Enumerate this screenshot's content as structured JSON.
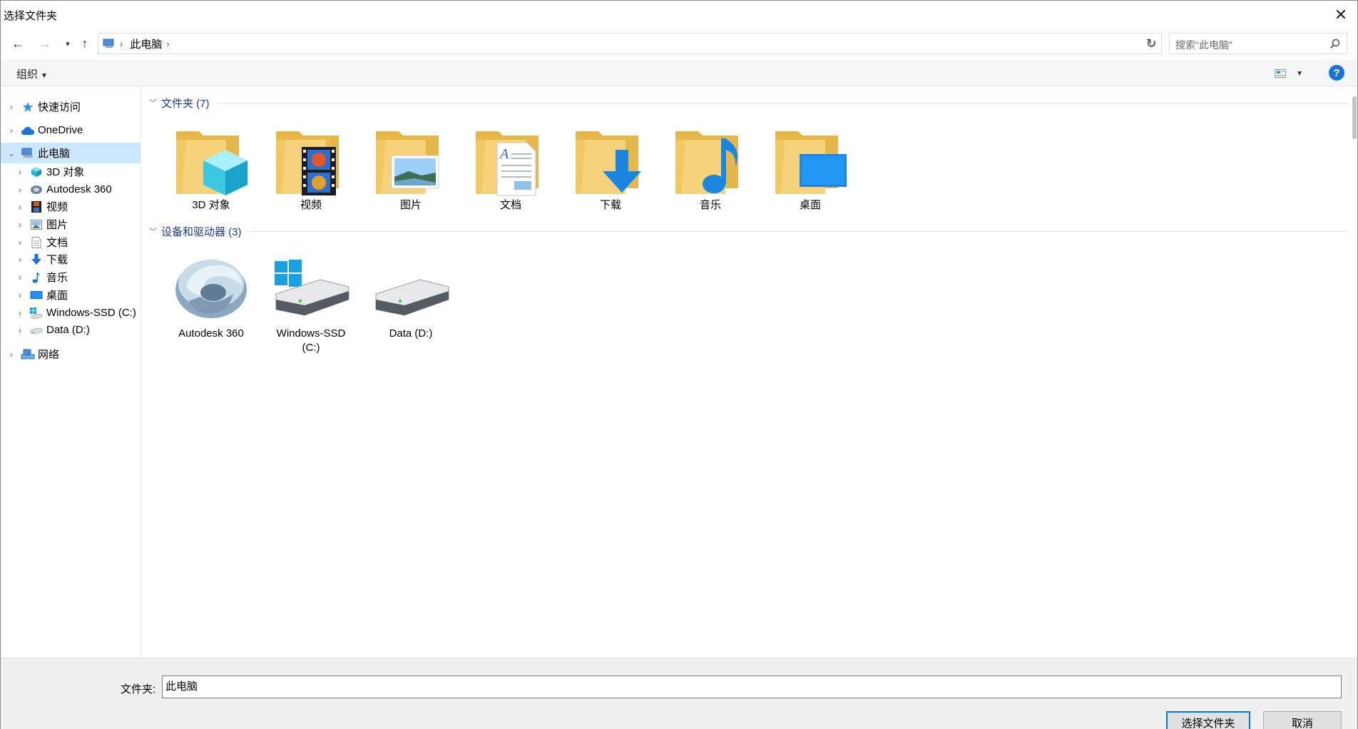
{
  "window": {
    "title": "选择文件夹"
  },
  "nav": {
    "address_path": "此电脑",
    "search_placeholder": "搜索\"此电脑\""
  },
  "toolbar": {
    "organize_label": "组织"
  },
  "tree": [
    {
      "label": "快速访问",
      "icon": "star-icon"
    },
    {
      "label": "OneDrive",
      "icon": "cloud-icon"
    },
    {
      "label": "此电脑",
      "icon": "computer-icon",
      "selected": true
    },
    {
      "label": "3D 对象",
      "icon": "cube-icon"
    },
    {
      "label": "Autodesk 360",
      "icon": "autodesk-icon"
    },
    {
      "label": "视频",
      "icon": "film-icon"
    },
    {
      "label": "图片",
      "icon": "picture-icon"
    },
    {
      "label": "文档",
      "icon": "document-icon"
    },
    {
      "label": "下载",
      "icon": "download-icon"
    },
    {
      "label": "音乐",
      "icon": "music-icon"
    },
    {
      "label": "桌面",
      "icon": "desktop-icon"
    },
    {
      "label": "Windows-SSD (C:)",
      "icon": "windows-drive-icon"
    },
    {
      "label": "Data (D:)",
      "icon": "drive-icon"
    },
    {
      "label": "网络",
      "icon": "network-icon"
    }
  ],
  "groups": {
    "folders_header": "文件夹 (7)",
    "devices_header": "设备和驱动器 (3)"
  },
  "folders": [
    {
      "label": "3D 对象",
      "icon": "cube-folder-icon"
    },
    {
      "label": "视频",
      "icon": "video-folder-icon"
    },
    {
      "label": "图片",
      "icon": "pictures-folder-icon"
    },
    {
      "label": "文档",
      "icon": "documents-folder-icon"
    },
    {
      "label": "下载",
      "icon": "downloads-folder-icon"
    },
    {
      "label": "音乐",
      "icon": "music-folder-icon"
    },
    {
      "label": "桌面",
      "icon": "desktop-folder-icon"
    }
  ],
  "devices": [
    {
      "label": "Autodesk 360",
      "icon": "autodesk-360-icon"
    },
    {
      "label": "Windows-SSD\n(C:)",
      "icon": "windows-ssd-icon"
    },
    {
      "label": "Data (D:)",
      "icon": "data-drive-icon"
    }
  ],
  "footer": {
    "folder_label": "文件夹:",
    "folder_value": "此电脑",
    "select_button": "选择文件夹",
    "cancel_button": "取消"
  },
  "colors": {
    "selection": "#cce8ff",
    "accent": "#0078d7",
    "group_header": "#1e3a8a",
    "folder": "#f5cf6c"
  }
}
